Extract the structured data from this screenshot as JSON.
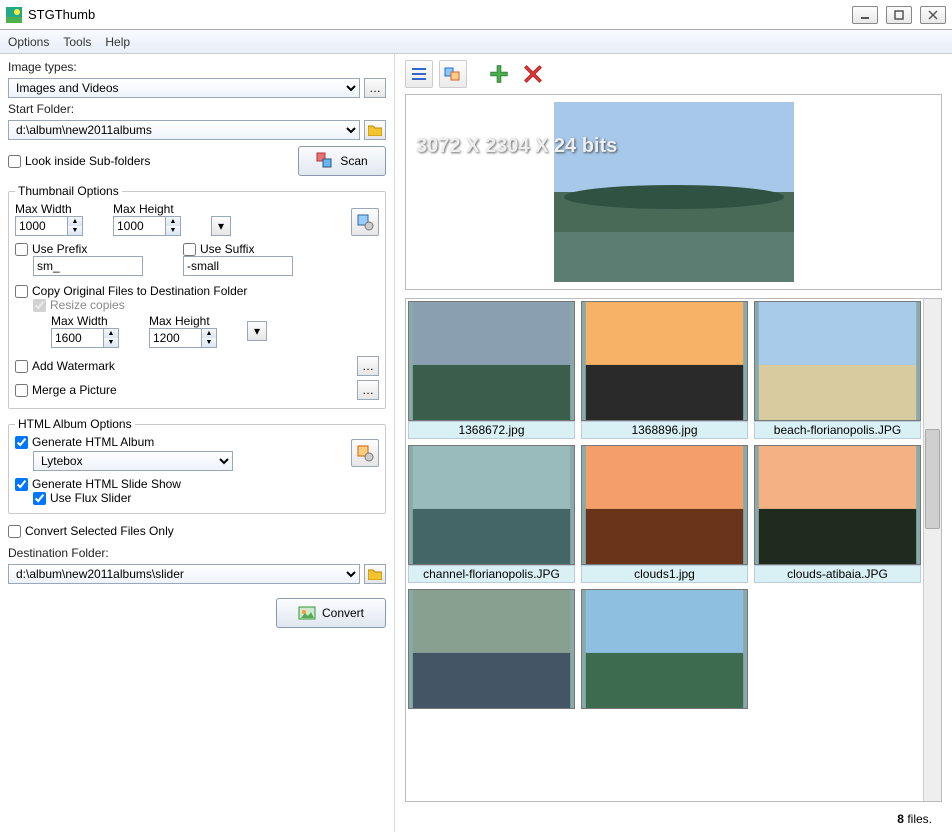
{
  "title": "STGThumb",
  "menu": [
    "Options",
    "Tools",
    "Help"
  ],
  "labels": {
    "imageTypes": "Image types:",
    "startFolder": "Start Folder:",
    "lookSub": "Look inside Sub-folders",
    "scan": "Scan",
    "thumbGroup": "Thumbnail Options",
    "maxW": "Max Width",
    "maxH": "Max Height",
    "usePrefix": "Use Prefix",
    "useSuffix": "Use Suffix",
    "copyOrig": "Copy Original Files to Destination Folder",
    "resizeCopies": "Resize copies",
    "addWatermark": "Add Watermark",
    "mergePic": "Merge a Picture",
    "htmlGroup": "HTML Album Options",
    "genAlbum": "Generate HTML Album",
    "genSlide": "Generate HTML Slide Show",
    "useFlux": "Use Flux Slider",
    "convertSel": "Convert Selected Files Only",
    "destFolder": "Destination Folder:",
    "convert": "Convert"
  },
  "values": {
    "imageTypes": "Images and Videos",
    "startFolder": "d:\\album\\new2011albums",
    "thumb_w": "1000",
    "thumb_h": "1000",
    "prefix": "sm_",
    "suffix": "-small",
    "copy_w": "1600",
    "copy_h": "1200",
    "album_type": "Lytebox",
    "destFolder": "d:\\album\\new2011albums\\slider"
  },
  "checks": {
    "lookSub": false,
    "usePrefix": false,
    "useSuffix": false,
    "copyOrig": false,
    "resizeCopies": true,
    "addWatermark": false,
    "mergePic": false,
    "genAlbum": true,
    "genSlide": true,
    "useFlux": true,
    "convertSel": false
  },
  "preview_dim": "3072 X 2304 X 24 bits",
  "files": [
    "1368672.jpg",
    "1368896.jpg",
    "beach-florianopolis.JPG",
    "channel-florianopolis.JPG",
    "clouds1.jpg",
    "clouds-atibaia.JPG",
    "",
    ""
  ],
  "status": {
    "count": "8",
    "suffix": " files."
  }
}
